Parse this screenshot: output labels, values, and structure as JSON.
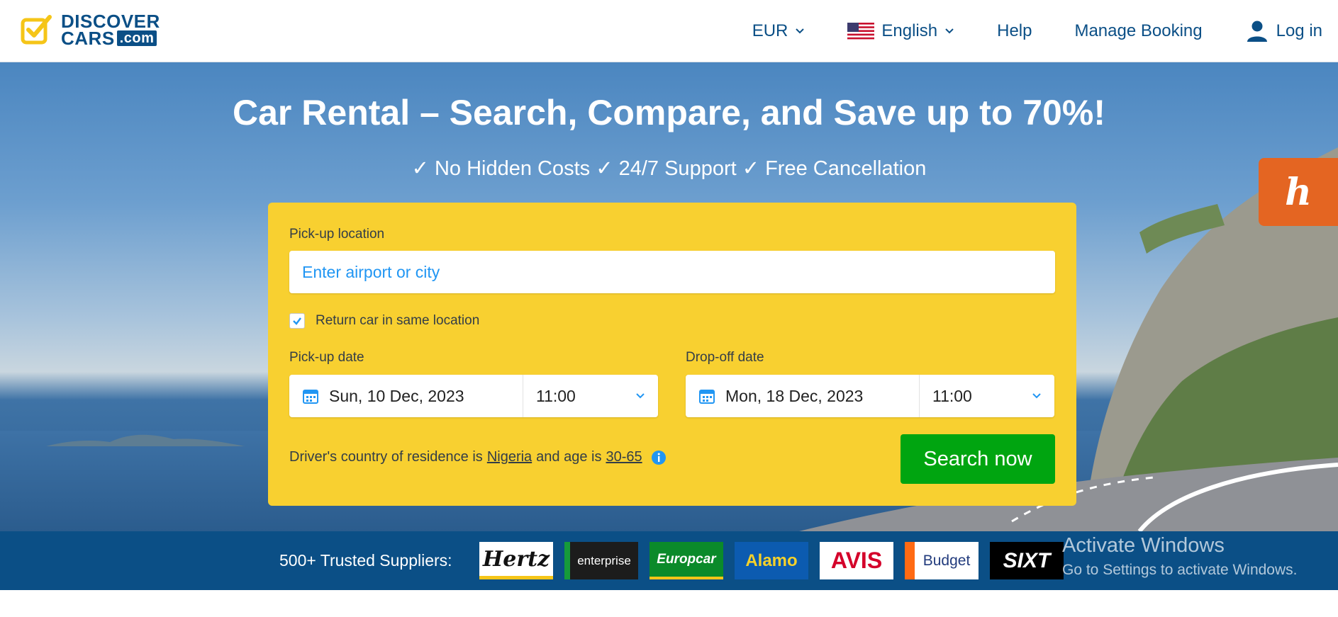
{
  "header": {
    "logo_line1": "DISCOVER",
    "logo_line2": "CARS",
    "logo_com": ".com",
    "currency": "EUR",
    "language": "English",
    "help": "Help",
    "manage_booking": "Manage Booking",
    "login": "Log in"
  },
  "hero": {
    "title": "Car Rental – Search, Compare, and Save up to 70%!",
    "subtitle": "✓ No Hidden Costs ✓ 24/7 Support ✓ Free Cancellation"
  },
  "search": {
    "pickup_location_label": "Pick-up location",
    "pickup_location_placeholder": "Enter airport or city",
    "return_same_label": "Return car in same location",
    "return_same_checked": true,
    "pickup_date_label": "Pick-up date",
    "pickup_date": "Sun, 10 Dec, 2023",
    "pickup_time": "11:00",
    "dropoff_date_label": "Drop-off date",
    "dropoff_date": "Mon, 18 Dec, 2023",
    "dropoff_time": "11:00",
    "driver_prefix": "Driver's country of residence is",
    "driver_country": "Nigeria",
    "driver_mid": "and age is",
    "driver_age": "30-65",
    "search_button": "Search now"
  },
  "suppliers": {
    "label": "500+ Trusted Suppliers:",
    "logos": [
      "Hertz",
      "enterprise",
      "Europcar",
      "Alamo",
      "AVIS",
      "Budget",
      "SIXT"
    ]
  },
  "watermark": {
    "line1": "Activate Windows",
    "line2": "Go to Settings to activate Windows."
  },
  "icons": {
    "honey": "h"
  },
  "colors": {
    "brand_blue": "#0b4f86",
    "search_yellow": "#f8d030",
    "search_green": "#00a510",
    "accent_blue": "#2196f3",
    "honey_orange": "#e46522"
  }
}
